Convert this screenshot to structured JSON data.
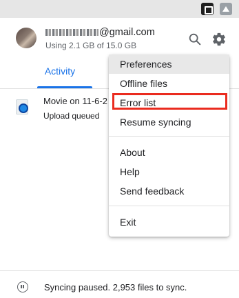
{
  "account": {
    "email_visible": "@gmail.com",
    "storage": "Using 2.1 GB of 15.0 GB"
  },
  "header": {
    "search_icon": "search-icon",
    "settings_icon": "gear-icon"
  },
  "tabs": [
    {
      "label": "Activity",
      "selected": true
    }
  ],
  "activity": {
    "items": [
      {
        "name": "Movie on 11-6-2",
        "status": "Upload queued"
      }
    ]
  },
  "menu": {
    "items": [
      {
        "label": "Preferences"
      },
      {
        "label": "Offline files"
      },
      {
        "label": "Error list"
      },
      {
        "label": "Resume syncing"
      },
      {
        "label": "About"
      },
      {
        "label": "Help"
      },
      {
        "label": "Send feedback"
      },
      {
        "label": "Exit"
      }
    ]
  },
  "footer": {
    "status": "Syncing paused. 2,953 files to sync."
  },
  "colors": {
    "accent": "#1a73e8",
    "highlight": "#ea2b1f"
  }
}
